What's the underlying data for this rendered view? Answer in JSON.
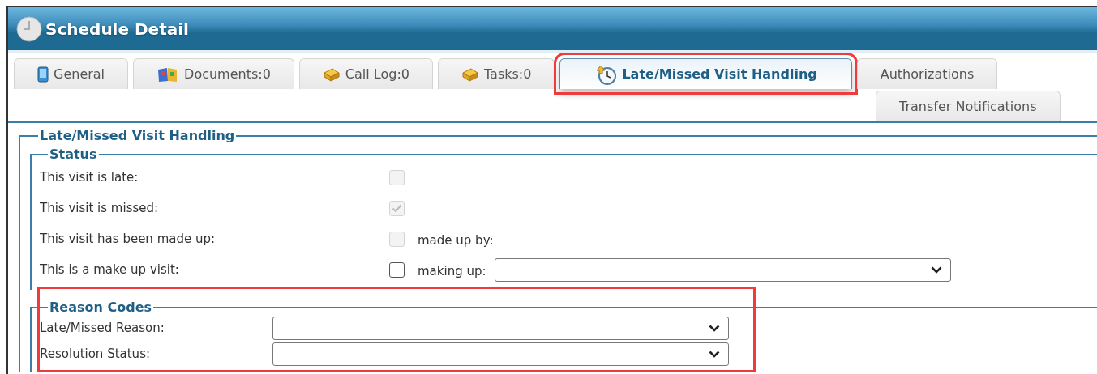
{
  "window": {
    "title": "Schedule Detail"
  },
  "tab_rows": [
    [
      {
        "label": "General",
        "kind": "device",
        "selected": false,
        "highlighted": false
      },
      {
        "label": "Documents:0",
        "kind": "book",
        "selected": false,
        "highlighted": false
      },
      {
        "label": "Call Log:0",
        "kind": "package",
        "selected": false,
        "highlighted": false
      },
      {
        "label": "Tasks:0",
        "kind": "package",
        "selected": false,
        "highlighted": false
      },
      {
        "label": "Late/Missed Visit Handling",
        "kind": "clock",
        "selected": true,
        "highlighted": true
      },
      {
        "label": "Authorizations",
        "kind": "plain",
        "selected": false,
        "highlighted": false
      }
    ],
    [
      {
        "label": "Transfer Notifications",
        "kind": "plain",
        "selected": false,
        "highlighted": false
      }
    ]
  ],
  "section": {
    "title": "Late/Missed Visit Handling",
    "status": {
      "title": "Status",
      "rows": [
        {
          "label": "This visit is late:",
          "checked": false,
          "disabled": true
        },
        {
          "label": "This visit is missed:",
          "checked": true,
          "disabled": true
        },
        {
          "label": "This visit has been made up:",
          "checked": false,
          "disabled": true,
          "extra": {
            "label": "made up by:",
            "kind": "text"
          }
        },
        {
          "label": "This is a make up visit:",
          "checked": false,
          "disabled": false,
          "extra": {
            "label": "making up:",
            "kind": "dropdown"
          }
        }
      ]
    },
    "reason_codes": {
      "title": "Reason Codes",
      "highlighted": true,
      "fields": [
        {
          "label": "Late/Missed Reason:"
        },
        {
          "label": "Resolution Status:"
        }
      ]
    }
  }
}
